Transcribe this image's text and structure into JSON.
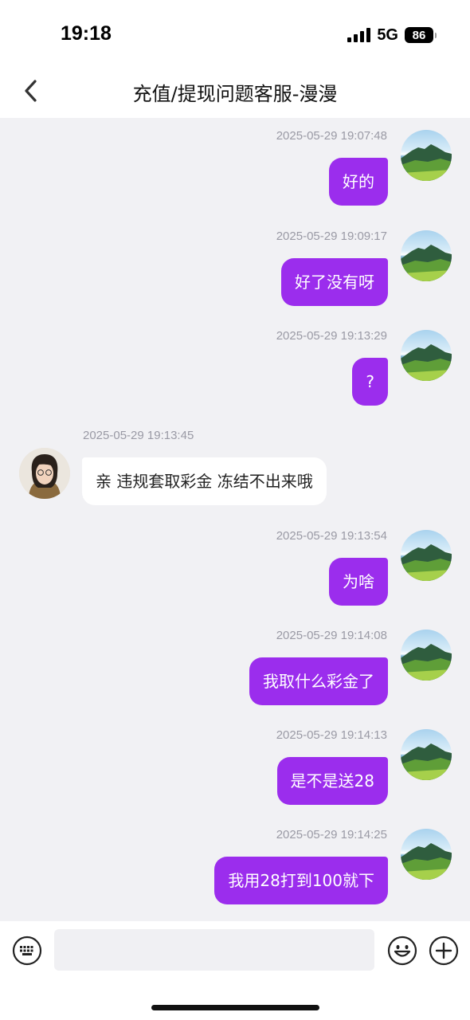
{
  "status_bar": {
    "time": "19:18",
    "network": "5G",
    "battery": "86"
  },
  "header": {
    "title": "充值/提现问题客服-漫漫",
    "back_icon": "chevron-left-icon"
  },
  "messages": [
    {
      "sender": "me",
      "time": "2025-05-29 19:07:48",
      "text": "好的"
    },
    {
      "sender": "me",
      "time": "2025-05-29 19:09:17",
      "text": "好了没有呀"
    },
    {
      "sender": "me",
      "time": "2025-05-29 19:13:29",
      "text": "?"
    },
    {
      "sender": "agent",
      "time": "2025-05-29 19:13:45",
      "text": "亲 违规套取彩金 冻结不出来哦"
    },
    {
      "sender": "me",
      "time": "2025-05-29 19:13:54",
      "text": "为啥"
    },
    {
      "sender": "me",
      "time": "2025-05-29 19:14:08",
      "text": "我取什么彩金了"
    },
    {
      "sender": "me",
      "time": "2025-05-29 19:14:13",
      "text": "是不是送28"
    },
    {
      "sender": "me",
      "time": "2025-05-29 19:14:25",
      "text": "我用28打到100就下"
    }
  ],
  "input_bar": {
    "placeholder": "",
    "icons": [
      "keyboard-icon",
      "emoji-icon",
      "plus-icon"
    ]
  },
  "colors": {
    "outgoing_bubble": "#9b2ded",
    "incoming_bubble": "#ffffff",
    "background": "#f1f1f4",
    "timestamp": "#9a9aa5"
  }
}
